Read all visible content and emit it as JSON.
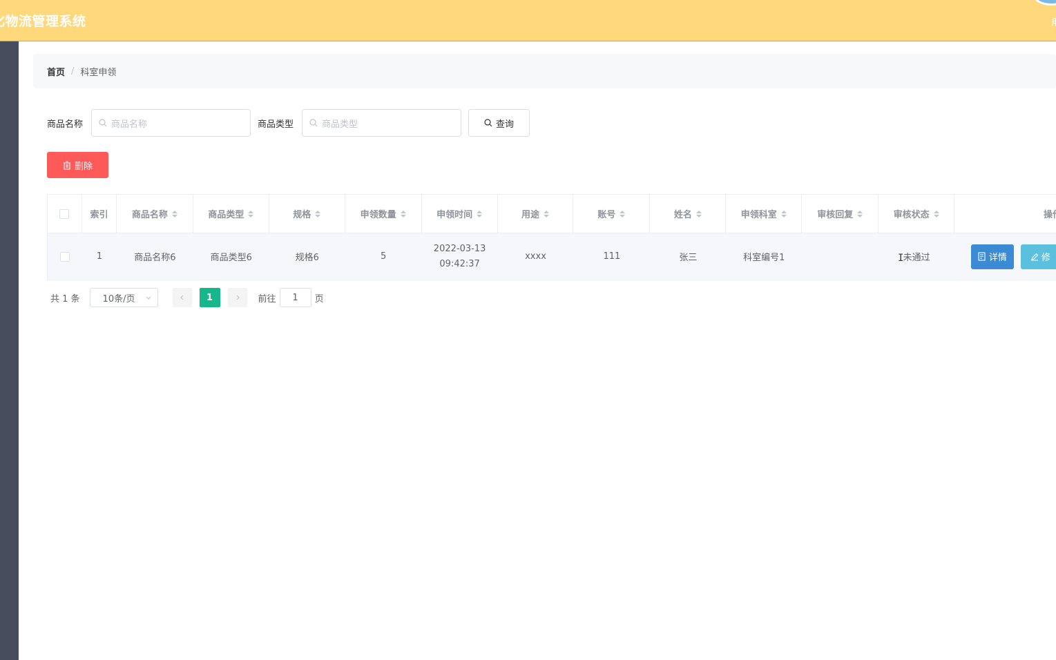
{
  "header": {
    "app_title": "化物流管理系统",
    "user_fragment": "用"
  },
  "breadcrumb": {
    "home": "首页",
    "separator": "/",
    "current": "科室申领"
  },
  "search": {
    "name_label": "商品名称",
    "name_placeholder": "商品名称",
    "type_label": "商品类型",
    "type_placeholder": "商品类型",
    "query_label": "查询"
  },
  "toolbar": {
    "delete_label": "删除"
  },
  "table": {
    "columns": [
      "索引",
      "商品名称",
      "商品类型",
      "规格",
      "申领数量",
      "申领时间",
      "用途",
      "账号",
      "姓名",
      "申领科室",
      "审核回复",
      "审核状态",
      "操作"
    ],
    "rows": [
      {
        "index": "1",
        "name": "商品名称6",
        "type": "商品类型6",
        "spec": "规格6",
        "qty": "5",
        "date": "2022-03-13",
        "time": "09:42:37",
        "usage": "xxxx",
        "account": "111",
        "person": "张三",
        "dept": "科室编号1",
        "reply": "",
        "status": "未通过",
        "detail_label": "详情",
        "edit_label": "修"
      }
    ]
  },
  "pager": {
    "total": "共 1 条",
    "page_size": "10条/页",
    "current_page": "1",
    "goto_label": "前往",
    "goto_value": "1",
    "page_unit": "页"
  },
  "colors": {
    "header_bg": "#fed87a",
    "sidebar_bg": "#474d5d",
    "delete_red": "#fe5a5a",
    "detail_blue": "#3a8bd4",
    "edit_cyan": "#5bc0de",
    "page_active": "#17b68b"
  }
}
